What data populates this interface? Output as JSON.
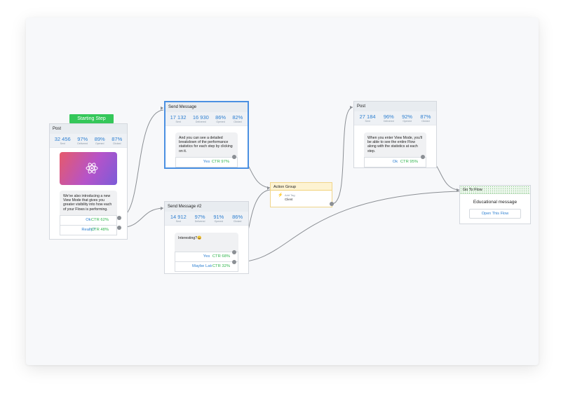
{
  "starting_step": {
    "label": "Starting Step"
  },
  "post1": {
    "title": "Post",
    "stats": [
      {
        "value": "32 456",
        "label": "Sent"
      },
      {
        "value": "97%",
        "label": "Delivered"
      },
      {
        "value": "89%",
        "label": "Opened"
      },
      {
        "value": "87%",
        "label": "Clicked"
      }
    ],
    "message": "We've also introducing a new View Mode that gives you greater visibility into how each of your Flows is performing.",
    "buttons": [
      {
        "label": "Ok",
        "ctr": "CTR 62%"
      },
      {
        "label": "Really?",
        "ctr": "CTR 48%"
      }
    ]
  },
  "send1": {
    "title": "Send Message",
    "stats": [
      {
        "value": "17 132",
        "label": "Sent"
      },
      {
        "value": "16 930",
        "label": "Delivered"
      },
      {
        "value": "86%",
        "label": "Opened"
      },
      {
        "value": "82%",
        "label": "Clicked"
      }
    ],
    "message": "And you can see a detailed breakdown of the performance statistics for each step by clicking on it.",
    "buttons": [
      {
        "label": "Yes",
        "ctr": "CTR 97%"
      }
    ]
  },
  "send2": {
    "title": "Send Message #2",
    "stats": [
      {
        "value": "14 912",
        "label": "Sent"
      },
      {
        "value": "97%",
        "label": "Delivered"
      },
      {
        "value": "91%",
        "label": "Opened"
      },
      {
        "value": "86%",
        "label": "Clicked"
      }
    ],
    "message": "Interesting?😀",
    "buttons": [
      {
        "label": "Yes",
        "ctr": "CTR 68%"
      },
      {
        "label": "Maybe Later",
        "ctr": "CTR 32%"
      }
    ]
  },
  "action": {
    "title": "Action Group",
    "action_label": "Add Tag",
    "action_value": "Client"
  },
  "post2": {
    "title": "Post",
    "stats": [
      {
        "value": "27 184",
        "label": "Sent"
      },
      {
        "value": "96%",
        "label": "Delivered"
      },
      {
        "value": "92%",
        "label": "Opened"
      },
      {
        "value": "87%",
        "label": "Clicked"
      }
    ],
    "message": "When you enter View Mode, you'll be able to see the entire Flow along with the statistics at each step.",
    "buttons": [
      {
        "label": "Ok",
        "ctr": "CTR 95%"
      }
    ]
  },
  "goto": {
    "title": "Go To Flow",
    "subtitle": "Educational message",
    "button": "Open This Flow"
  },
  "colors": {
    "accent": "#2f80d1",
    "ctr": "#2fb44b",
    "start": "#34c759",
    "selected": "#4a90e2",
    "action_header": "#fdf3d2"
  }
}
